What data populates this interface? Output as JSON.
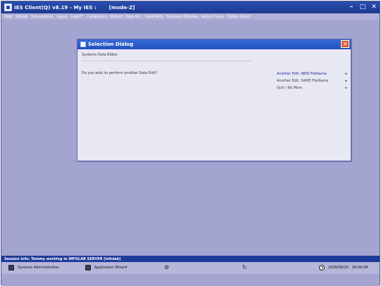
{
  "window": {
    "title": "IES Client(Q) v8.19 - My IES :       [mode-Z]",
    "controls": {
      "minimize": "–",
      "maximize": "□",
      "close": "✕"
    }
  },
  "menu": {
    "items": [
      "Help",
      "Infolab",
      "Connections",
      "Logon",
      "LogoFF",
      "Companion",
      "Wizard",
      "How do I",
      "DataMarts",
      "Business Modules",
      "Action Focus",
      "Option Select"
    ]
  },
  "dialog": {
    "title": "Selection Dialog",
    "close_label": "✕",
    "header": "Systems Data Editor",
    "question": "Do you wish to perform another Data Edit?",
    "options": [
      {
        "label": "Another Edit, NEW FileName",
        "arrow": "▸"
      },
      {
        "label": "Another Edit, SAME FileName",
        "arrow": "▸"
      },
      {
        "label": "Quit / No More",
        "arrow": "▸"
      }
    ]
  },
  "status": {
    "text": "Session Info: Tommy working in INFOLAB SERVER  [infolab]"
  },
  "taskbar": {
    "systems_admin": "Systems Administration",
    "app_wizard": "Application Wizard",
    "date": "2009/06/20",
    "time": "09:09:08"
  }
}
